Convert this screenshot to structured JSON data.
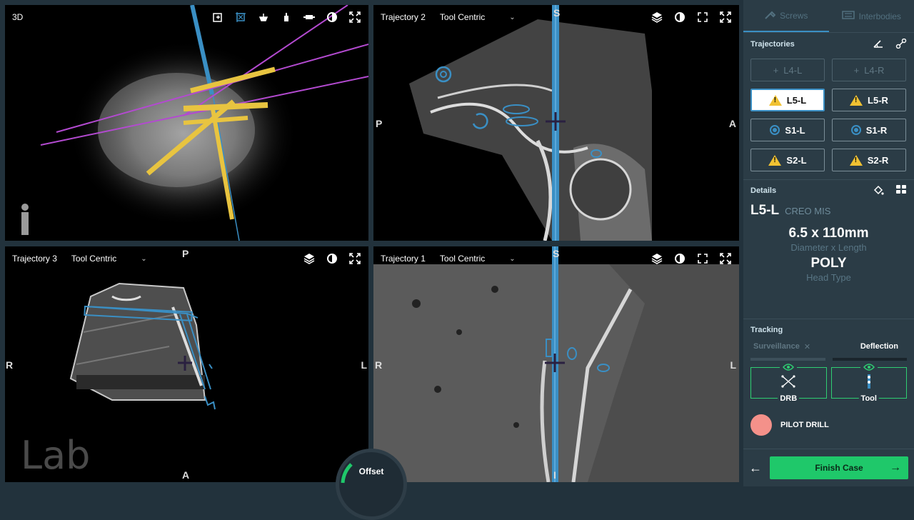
{
  "viewports": {
    "v3d": {
      "title": "3D"
    },
    "t2": {
      "title": "Trajectory 2",
      "mode": "Tool Centric",
      "orient": {
        "top": "S",
        "left": "P",
        "right": "A"
      }
    },
    "t3": {
      "title": "Trajectory 3",
      "mode": "Tool Centric",
      "orient": {
        "top": "P",
        "left": "R",
        "right": "L",
        "bottom": "A"
      }
    },
    "t1": {
      "title": "Trajectory 1",
      "mode": "Tool Centric",
      "orient": {
        "top": "S",
        "left": "R",
        "right": "L",
        "bottom": "I"
      }
    }
  },
  "watermark": "Lab",
  "offset_label": "Offset",
  "panel": {
    "tabs": {
      "screws": "Screws",
      "interbodies": "Interbodies"
    },
    "trajectories": {
      "title": "Trajectories",
      "items": [
        {
          "label": "L4-L",
          "status": "add"
        },
        {
          "label": "L4-R",
          "status": "add"
        },
        {
          "label": "L5-L",
          "status": "warning",
          "selected": true
        },
        {
          "label": "L5-R",
          "status": "warning"
        },
        {
          "label": "S1-L",
          "status": "planned"
        },
        {
          "label": "S1-R",
          "status": "planned"
        },
        {
          "label": "S2-L",
          "status": "warning"
        },
        {
          "label": "S2-R",
          "status": "warning"
        }
      ]
    },
    "details": {
      "title": "Details",
      "name": "L5-L",
      "model": "CREO MIS",
      "size": "6.5 x 110mm",
      "size_caption": "Diameter x Length",
      "head": "POLY",
      "head_caption": "Head Type"
    },
    "tracking": {
      "title": "Tracking",
      "surveillance": "Surveillance",
      "deflection": "Deflection",
      "drb": "DRB",
      "tool": "Tool"
    },
    "drill": "PILOT DRILL",
    "finish": "Finish Case"
  },
  "colors": {
    "accent": "#3a8fc4",
    "success": "#1fc86a",
    "warning": "#f1c232",
    "drill": "#f4918a",
    "panel_bg": "#2b3c46"
  }
}
